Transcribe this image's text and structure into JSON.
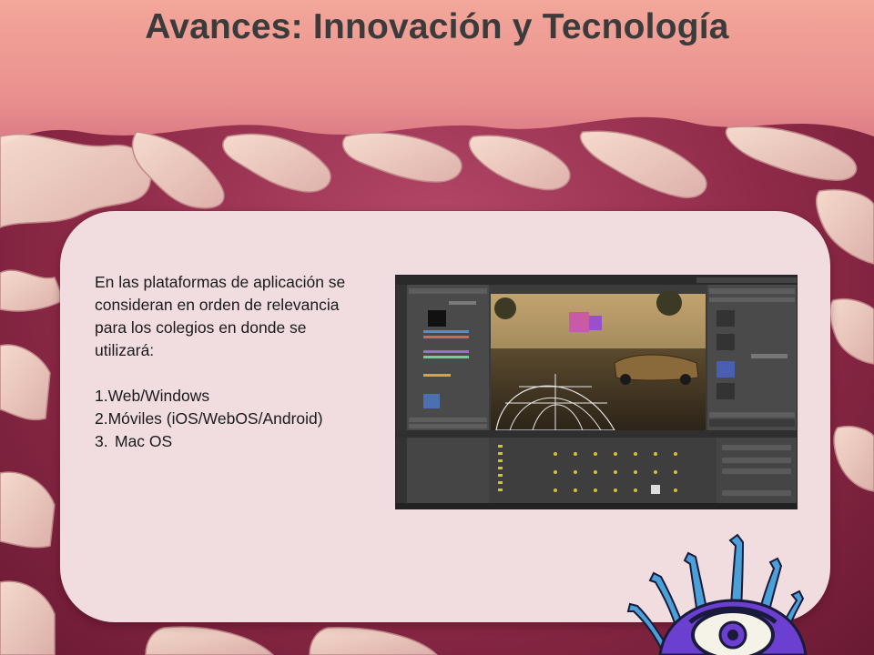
{
  "slide": {
    "title": "Avances: Innovación y Tecnología",
    "intro": "En las plataformas de aplicación se consideran en orden de relevancia para los colegios en donde se utilizará:",
    "platforms": [
      {
        "num": "1.",
        "label": "Web/Windows"
      },
      {
        "num": "2.",
        "label": "Móviles (iOS/WebOS/Android)"
      },
      {
        "num": "3.",
        "label": "Mac OS"
      }
    ]
  },
  "colors": {
    "title": "#3b3b3b",
    "panel": "#f1dde0",
    "background": "#8e2a48",
    "monster": "#6b3fd0"
  },
  "icons": [
    "editor-screenshot-image",
    "cartoon-monster-illustration"
  ]
}
